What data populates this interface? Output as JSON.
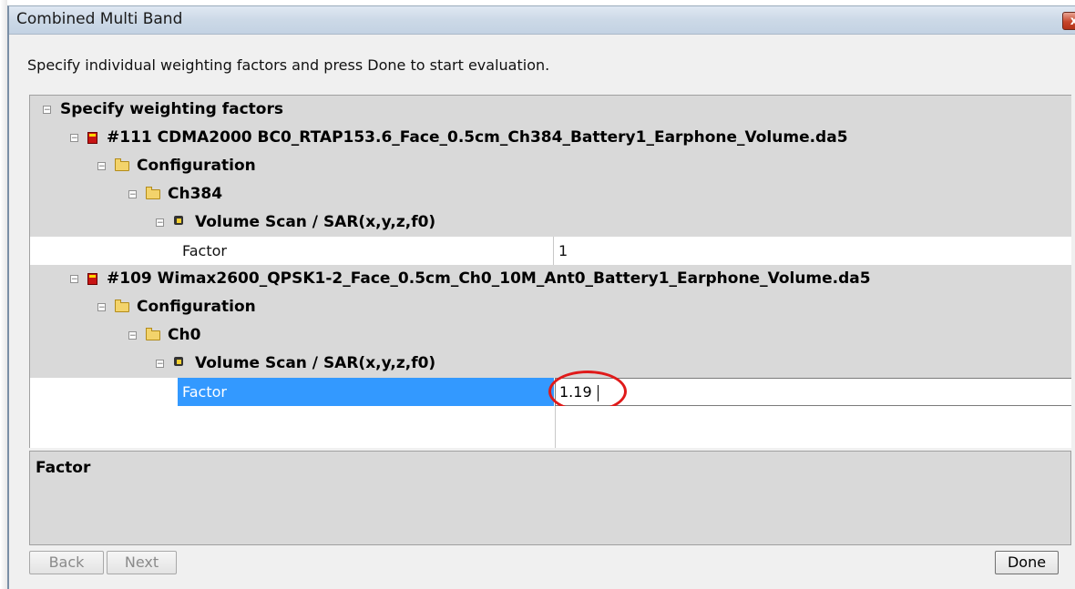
{
  "window": {
    "title": "Combined Multi Band",
    "close_label": "x"
  },
  "instructions": "Specify individual weighting factors and press Done to start evaluation.",
  "tree": {
    "root": {
      "label": "Specify weighting factors",
      "expander": "⊟"
    },
    "measurements": [
      {
        "label": "#111 CDMA2000 BC0_RTAP153.6_Face_0.5cm_Ch384_Battery1_Earphone_Volume.da5",
        "configuration": "Configuration",
        "channel": "Ch384",
        "scan": "Volume Scan / SAR(x,y,z,f0)",
        "property": {
          "name": "Factor",
          "value": "1"
        }
      },
      {
        "label": "#109 Wimax2600_QPSK1-2_Face_0.5cm_Ch0_10M_Ant0_Battery1_Earphone_Volume.da5",
        "configuration": "Configuration",
        "channel": "Ch0",
        "scan": "Volume Scan / SAR(x,y,z,f0)",
        "property": {
          "name": "Factor",
          "value": "1.19"
        }
      }
    ]
  },
  "description": {
    "title": "Factor"
  },
  "buttons": {
    "back": "Back",
    "next": "Next",
    "done": "Done"
  },
  "colors": {
    "selection": "#3399ff",
    "annotation": "#e01a1a",
    "panel": "#d9d9d9"
  },
  "icons": {
    "file": "measurement-file-icon",
    "folder": "folder-icon",
    "scan": "volume-scan-icon"
  }
}
